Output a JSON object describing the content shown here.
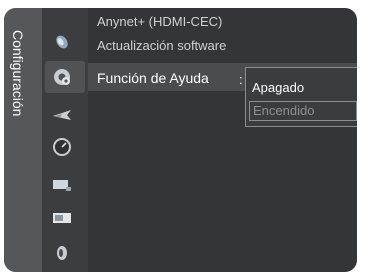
{
  "sidebar": {
    "label": "Configuración"
  },
  "icons": [
    "satellite-icon",
    "gear-icon",
    "plane-icon",
    "clock-icon",
    "input-icon",
    "picture-icon",
    "sound-icon"
  ],
  "menu": {
    "items": [
      {
        "label": "Anynet+ (HDMI-CEC)"
      },
      {
        "label": "Actualización software"
      },
      {
        "label": "Función de Ayuda"
      }
    ],
    "separator": ":"
  },
  "dropdown": {
    "options": [
      "Apagado",
      "Encendido"
    ],
    "selected": "Apagado"
  }
}
